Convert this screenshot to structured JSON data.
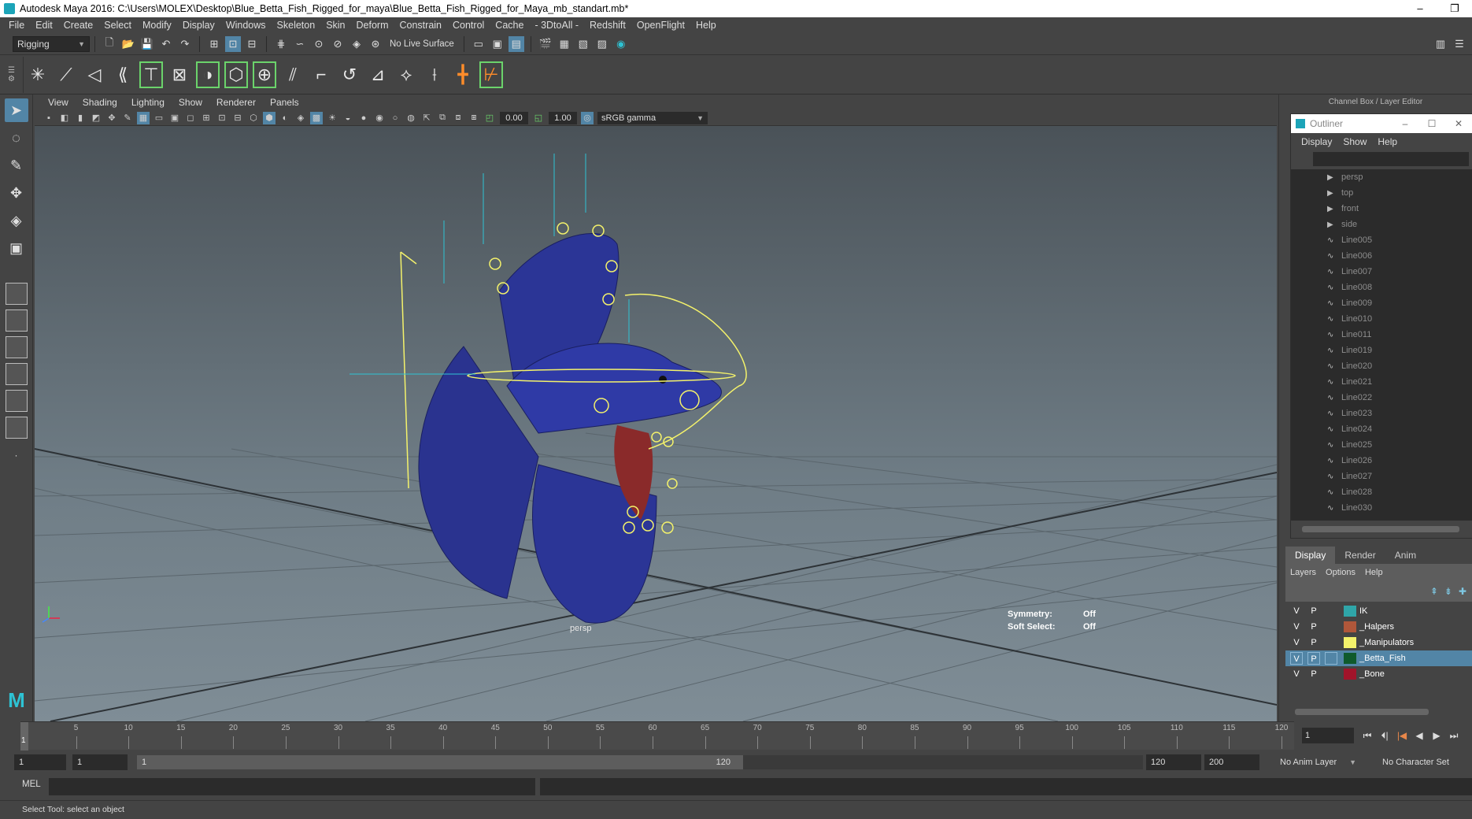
{
  "window": {
    "title": "Autodesk Maya 2016: C:\\Users\\MOLEX\\Desktop\\Blue_Betta_Fish_Rigged_for_maya\\Blue_Betta_Fish_Rigged_for_Maya_mb_standart.mb*",
    "minimize": "–",
    "restore": "❐"
  },
  "menu": [
    "File",
    "Edit",
    "Create",
    "Select",
    "Modify",
    "Display",
    "Windows",
    "Skeleton",
    "Skin",
    "Deform",
    "Constrain",
    "Control",
    "Cache",
    "- 3DtoAll -",
    "Redshift",
    "OpenFlight",
    "Help"
  ],
  "statusline": {
    "menuset": "Rigging",
    "live_surface": "No Live Surface"
  },
  "viewport": {
    "menu": [
      "View",
      "Shading",
      "Lighting",
      "Show",
      "Renderer",
      "Panels"
    ],
    "near": "0.00",
    "far": "1.00",
    "color_management": "sRGB gamma",
    "camera_label": "persp",
    "hud": {
      "symmetry_label": "Symmetry:",
      "symmetry_value": "Off",
      "soft_select_label": "Soft Select:",
      "soft_select_value": "Off"
    }
  },
  "right_panel": {
    "title": "Channel Box / Layer Editor",
    "outliner": {
      "title": "Outliner",
      "menu": [
        "Display",
        "Show",
        "Help"
      ],
      "items": [
        {
          "icon": "camera-icon",
          "label": "persp"
        },
        {
          "icon": "camera-icon",
          "label": "top"
        },
        {
          "icon": "camera-icon",
          "label": "front"
        },
        {
          "icon": "camera-icon",
          "label": "side"
        },
        {
          "icon": "curve-icon",
          "label": "Line005"
        },
        {
          "icon": "curve-icon",
          "label": "Line006"
        },
        {
          "icon": "curve-icon",
          "label": "Line007"
        },
        {
          "icon": "curve-icon",
          "label": "Line008"
        },
        {
          "icon": "curve-icon",
          "label": "Line009"
        },
        {
          "icon": "curve-icon",
          "label": "Line010"
        },
        {
          "icon": "curve-icon",
          "label": "Line011"
        },
        {
          "icon": "curve-icon",
          "label": "Line019"
        },
        {
          "icon": "curve-icon",
          "label": "Line020"
        },
        {
          "icon": "curve-icon",
          "label": "Line021"
        },
        {
          "icon": "curve-icon",
          "label": "Line022"
        },
        {
          "icon": "curve-icon",
          "label": "Line023"
        },
        {
          "icon": "curve-icon",
          "label": "Line024"
        },
        {
          "icon": "curve-icon",
          "label": "Line025"
        },
        {
          "icon": "curve-icon",
          "label": "Line026"
        },
        {
          "icon": "curve-icon",
          "label": "Line027"
        },
        {
          "icon": "curve-icon",
          "label": "Line028"
        },
        {
          "icon": "curve-icon",
          "label": "Line030"
        }
      ]
    },
    "layer_tabs": [
      "Display",
      "Render",
      "Anim"
    ],
    "layer_menu": [
      "Layers",
      "Options",
      "Help"
    ],
    "layers": [
      {
        "v": "V",
        "p": "P",
        "color": "#2fa5a8",
        "name": "IK",
        "selected": false
      },
      {
        "v": "V",
        "p": "P",
        "color": "#b0573a",
        "name": "_Halpers",
        "selected": false
      },
      {
        "v": "V",
        "p": "P",
        "color": "#f4f26b",
        "name": "_Manipulators",
        "selected": false
      },
      {
        "v": "V",
        "p": "P",
        "color": "#0f5a2c",
        "name": "_Betta_Fish",
        "selected": true
      },
      {
        "v": "V",
        "p": "P",
        "color": "#a1142a",
        "name": "_Bone",
        "selected": false
      }
    ]
  },
  "timeline": {
    "ticks": [
      "5",
      "10",
      "15",
      "20",
      "25",
      "30",
      "35",
      "40",
      "45",
      "50",
      "55",
      "60",
      "65",
      "70",
      "75",
      "80",
      "85",
      "90",
      "95",
      "100",
      "105",
      "110",
      "115",
      "120"
    ],
    "current_frame_marker": "1",
    "current_frame": "1"
  },
  "range": {
    "start": "1",
    "playback_start": "1",
    "range_start": "1",
    "range_end": "120",
    "playback_end": "120",
    "end": "200",
    "anim_layer": "No Anim Layer",
    "character_set": "No Character Set"
  },
  "command": {
    "lang": "MEL"
  },
  "help_line": "Select Tool: select an object"
}
